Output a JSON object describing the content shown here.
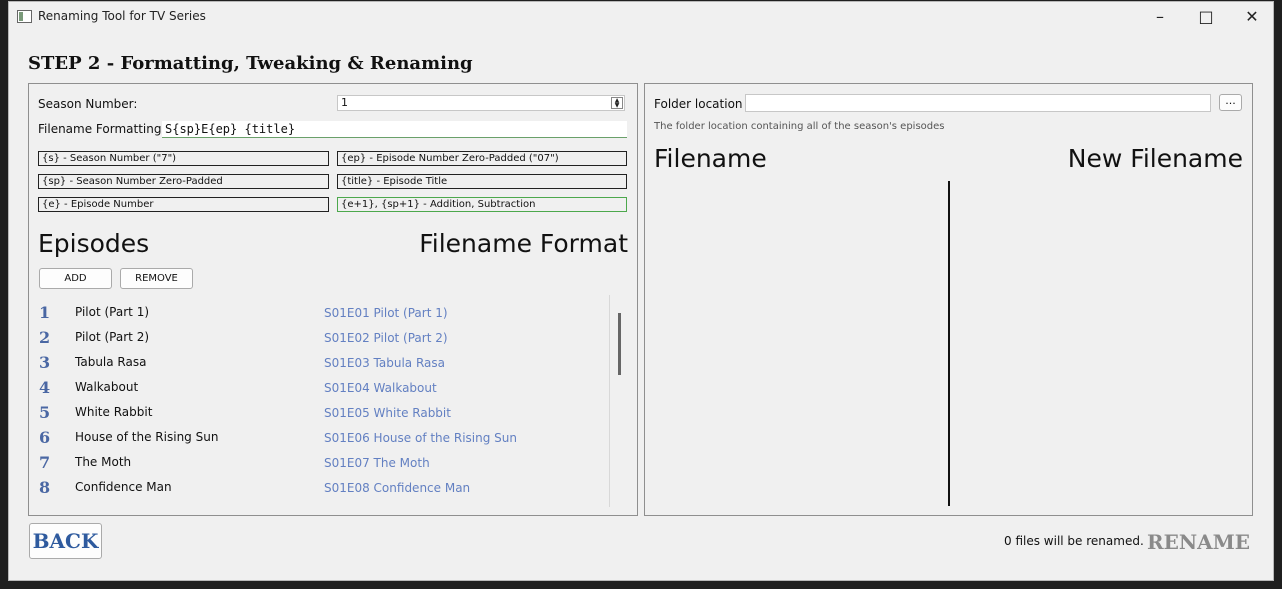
{
  "window": {
    "title": "Renaming Tool for TV Series",
    "minimize_icon": "minimize-icon",
    "maximize_icon": "maximize-icon",
    "close_icon": "close-icon"
  },
  "step_title": "STEP 2 - Formatting, Tweaking & Renaming",
  "left": {
    "season_label": "Season Number:",
    "season_value": "1",
    "format_label": "Filename Formatting",
    "format_value": "S{sp}E{ep} {title}",
    "tokens": [
      "{s} - Season Number (\"7\")",
      "{ep} - Episode Number Zero-Padded (\"07\")",
      "{sp} - Season Number Zero-Padded",
      "{title} - Episode Title",
      "{e} - Episode Number",
      "{e+1}, {sp+1} - Addition, Subtraction"
    ],
    "episodes_heading": "Episodes",
    "format_heading": "Filename Format",
    "add_label": "ADD",
    "remove_label": "REMOVE",
    "episodes": [
      {
        "num": "1",
        "title": "Pilot (Part 1)",
        "formatted": "S01E01 Pilot (Part 1)"
      },
      {
        "num": "2",
        "title": "Pilot (Part 2)",
        "formatted": "S01E02 Pilot (Part 2)"
      },
      {
        "num": "3",
        "title": "Tabula Rasa",
        "formatted": "S01E03 Tabula Rasa"
      },
      {
        "num": "4",
        "title": "Walkabout",
        "formatted": "S01E04 Walkabout"
      },
      {
        "num": "5",
        "title": "White Rabbit",
        "formatted": "S01E05 White Rabbit"
      },
      {
        "num": "6",
        "title": "House of the Rising Sun",
        "formatted": "S01E06 House of the Rising Sun"
      },
      {
        "num": "7",
        "title": "The Moth",
        "formatted": "S01E07 The Moth"
      },
      {
        "num": "8",
        "title": "Confidence Man",
        "formatted": "S01E08 Confidence Man"
      }
    ]
  },
  "right": {
    "folder_label": "Folder location",
    "folder_value": "",
    "browse_label": "...",
    "hint": "The folder location containing all of the season's episodes",
    "filename_heading": "Filename",
    "new_filename_heading": "New Filename"
  },
  "footer": {
    "back_label": "BACK",
    "status": "0 files will be renamed.",
    "rename_label": "RENAME"
  },
  "colors": {
    "episode_number": "#4a67a3",
    "formatted_name": "#6380c2",
    "back_text": "#2e5a9e",
    "rename_disabled": "#8a8a8a"
  }
}
